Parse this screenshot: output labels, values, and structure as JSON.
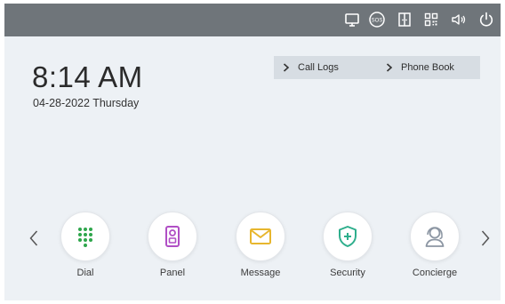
{
  "statusbar": {
    "icons": [
      "monitor-icon",
      "sos-icon",
      "door-icon",
      "qr-code-icon",
      "volume-icon",
      "power-icon"
    ],
    "sos_label": "SOS",
    "color": "#ffffff",
    "background": "#6f757a"
  },
  "clock": {
    "time": "8:14 AM",
    "date": "04-28-2022 Thursday"
  },
  "quicklinks": [
    {
      "label": "Call Logs",
      "icon": "chevron-right-icon"
    },
    {
      "label": "Phone Book",
      "icon": "chevron-right-icon"
    }
  ],
  "apps": [
    {
      "label": "Dial",
      "icon": "dialpad-icon",
      "color": "#2ea64b"
    },
    {
      "label": "Panel",
      "icon": "door-panel-icon",
      "color": "#b04fc5"
    },
    {
      "label": "Message",
      "icon": "envelope-icon",
      "color": "#e7b62e"
    },
    {
      "label": "Security",
      "icon": "shield-plus-icon",
      "color": "#2eae8c"
    },
    {
      "label": "Concierge",
      "icon": "concierge-icon",
      "color": "#8c96a3"
    }
  ],
  "nav": {
    "prev_icon": "chevron-left-icon",
    "next_icon": "chevron-right-icon"
  },
  "colors": {
    "screen_background": "#edf1f5",
    "quicklinks_background": "#d7dde3"
  }
}
